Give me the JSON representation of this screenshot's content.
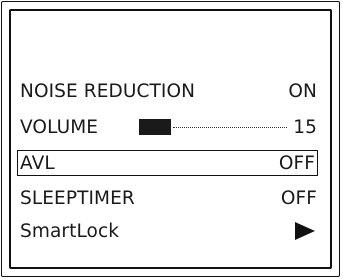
{
  "menu": {
    "noise_reduction": {
      "label": "NOISE REDUCTION",
      "value": "ON"
    },
    "volume": {
      "label": "VOLUME",
      "value": "15",
      "level_fraction": 0.15
    },
    "avl": {
      "label": "AVL",
      "value": "OFF",
      "selected": true
    },
    "sleeptimer": {
      "label": "SLEEPTIMER",
      "value": "OFF"
    },
    "smartlock": {
      "label": "SmartLock",
      "icon": "play-arrow-icon"
    }
  }
}
